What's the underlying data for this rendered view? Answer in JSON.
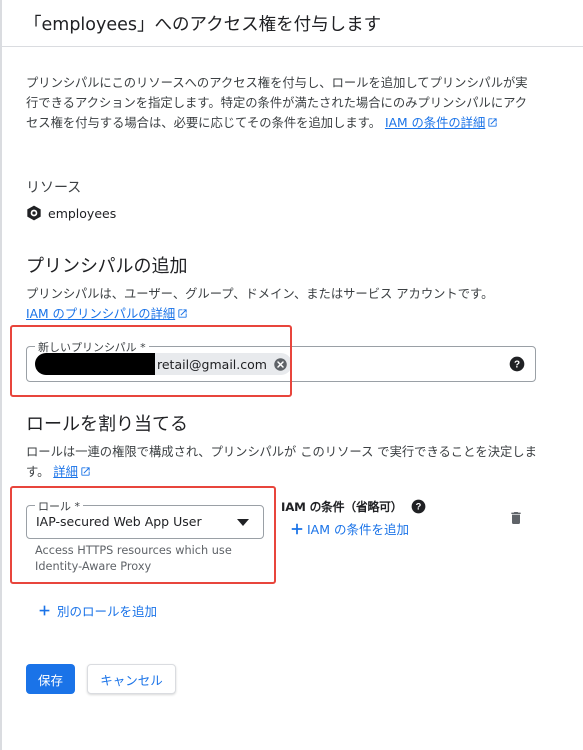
{
  "dialog": {
    "title": "「employees」へのアクセス権を付与します"
  },
  "intro": {
    "text": "プリンシパルにこのリソースへのアクセス権を付与し、ロールを追加してプリンシパルが実行できるアクションを指定します。特定の条件が満たされた場合にのみプリンシパルにアクセス権を付与する場合は、必要に応じてその条件を追加します。",
    "link_text": "IAM の条件の詳細"
  },
  "resource": {
    "label": "リソース",
    "name": "employees",
    "icon": "gear-hex-icon"
  },
  "principals": {
    "heading": "プリンシパルの追加",
    "description": "プリンシパルは、ユーザー、グループ、ドメイン、またはサービス アカウントです。",
    "link_text": "IAM のプリンシパルの詳細",
    "field_label": "新しいプリンシパル *",
    "chip_value": "retail@gmail.com"
  },
  "roles": {
    "heading": "ロールを割り当てる",
    "description": "ロールは一連の権限で構成され、プリンシパルが このリソース で実行できることを決定します。",
    "link_text": "詳細",
    "role_field_label": "ロール *",
    "role_value": "IAP-secured Web App User",
    "role_hint_line1": "Access HTTPS resources which use",
    "role_hint_line2": "Identity-Aware Proxy",
    "condition_label": "IAM の条件（省略可）",
    "add_condition": "IAM の条件を追加",
    "add_role": "別のロールを追加"
  },
  "footer": {
    "save": "保存",
    "cancel": "キャンセル"
  },
  "colors": {
    "primary": "#1a73e8",
    "highlight": "#e8453c"
  }
}
